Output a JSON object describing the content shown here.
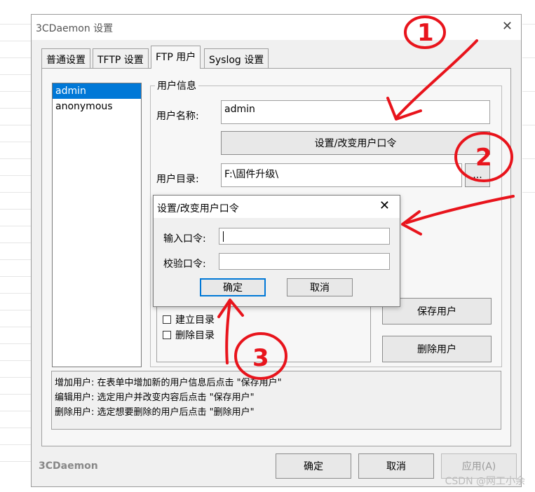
{
  "window": {
    "title": "3CDaemon 设置",
    "close_icon": "close-icon"
  },
  "tabs": [
    {
      "label": "普通设置",
      "active": false
    },
    {
      "label": "TFTP 设置",
      "active": false
    },
    {
      "label": "FTP 用户",
      "active": true
    },
    {
      "label": "Syslog 设置",
      "active": false
    }
  ],
  "users": [
    "admin",
    "anonymous"
  ],
  "selected_user": "admin",
  "user_info": {
    "group_title": "用户信息",
    "username_label": "用户名称:",
    "username_value": "admin",
    "set_password_button": "设置/改变用户口令",
    "directory_label": "用户目录:",
    "directory_value": "F:\\固件升级\\",
    "browse_button": "...",
    "create_dir_label": "建立目录",
    "delete_dir_label": "删除目录",
    "save_user_button": "保存用户",
    "delete_user_button": "删除用户"
  },
  "help_text": [
    "增加用户: 在表单中增加新的用户信息后点击 \"保存用户\"",
    "编辑用户: 选定用户并改变内容后点击 \"保存用户\"",
    "删除用户: 选定想要删除的用户后点击 \"删除用户\""
  ],
  "footer": {
    "brand": "3CDaemon",
    "ok_button": "确定",
    "cancel_button": "取消",
    "apply_button": "应用(A)"
  },
  "dialog": {
    "title": "设置/改变用户口令",
    "enter_password_label": "输入口令:",
    "enter_password_value": "",
    "verify_password_label": "校验口令:",
    "verify_password_value": "",
    "ok_button": "确定",
    "cancel_button": "取消"
  },
  "annotations": {
    "mark_1": "1",
    "mark_2": "2",
    "mark_3": "3",
    "color": "#e8141c"
  },
  "watermark": "CSDN @网工小余"
}
